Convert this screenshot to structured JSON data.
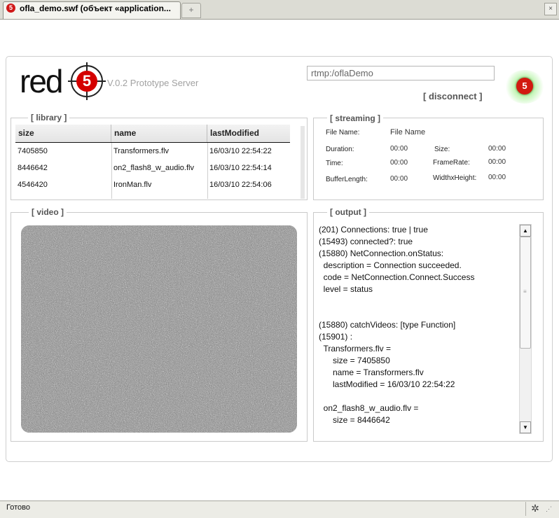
{
  "browser": {
    "tab_title": "ofla_demo.swf (объект «application...",
    "favicon_glyph": "5",
    "new_tab_glyph": "+",
    "close_glyph": "×",
    "status_text": "Готово"
  },
  "header": {
    "logo_text": "red",
    "logo_badge": "5",
    "version": "V.0.2 Prototype Server",
    "rtmp_url": "rtmp:/oflaDemo",
    "disconnect_label": "[ disconnect ]",
    "status_badge": "5",
    "colors": {
      "logo_red": "#d40000",
      "status_glow": "#8ceb6e"
    }
  },
  "library": {
    "title": "[ library ]",
    "columns": [
      "size",
      "name",
      "lastModified"
    ],
    "rows": [
      {
        "size": "7405850",
        "name": "Transformers.flv",
        "lastModified": "16/03/10 22:54:22"
      },
      {
        "size": "8446642",
        "name": "on2_flash8_w_audio.flv",
        "lastModified": "16/03/10 22:54:14"
      },
      {
        "size": "4546420",
        "name": "IronMan.flv",
        "lastModified": "16/03/10 22:54:06"
      }
    ]
  },
  "streaming": {
    "title": "[ streaming ]",
    "file_name_label": "File Name:",
    "file_name_value": "File Name",
    "duration_label": "Duration:",
    "duration_value": "00:00",
    "size_label": "Size:",
    "size_value": "00:00",
    "time_label": "Time:",
    "time_value": "00:00",
    "framerate_label": "FrameRate:",
    "framerate_value": "00:00",
    "bufferlength_label": "BufferLength:",
    "bufferlength_value": "00:00",
    "widthxheight_label": "WidthxHeight:",
    "widthxheight_value": "00:00"
  },
  "video": {
    "title": "[ video ]"
  },
  "output": {
    "title": "[ output ]",
    "lines": [
      "(201) Connections: true | true",
      "(15493) connected?: true",
      "(15880) NetConnection.onStatus:",
      "  description = Connection succeeded.",
      "  code = NetConnection.Connect.Success",
      "  level = status",
      "",
      "",
      "(15880) catchVideos: [type Function]",
      "(15901) :",
      "  Transformers.flv =",
      "      size = 7405850",
      "      name = Transformers.flv",
      "      lastModified = 16/03/10 22:54:22",
      "",
      "  on2_flash8_w_audio.flv =",
      "      size = 8446642"
    ],
    "scroll_up_glyph": "▲",
    "scroll_down_glyph": "▼"
  }
}
